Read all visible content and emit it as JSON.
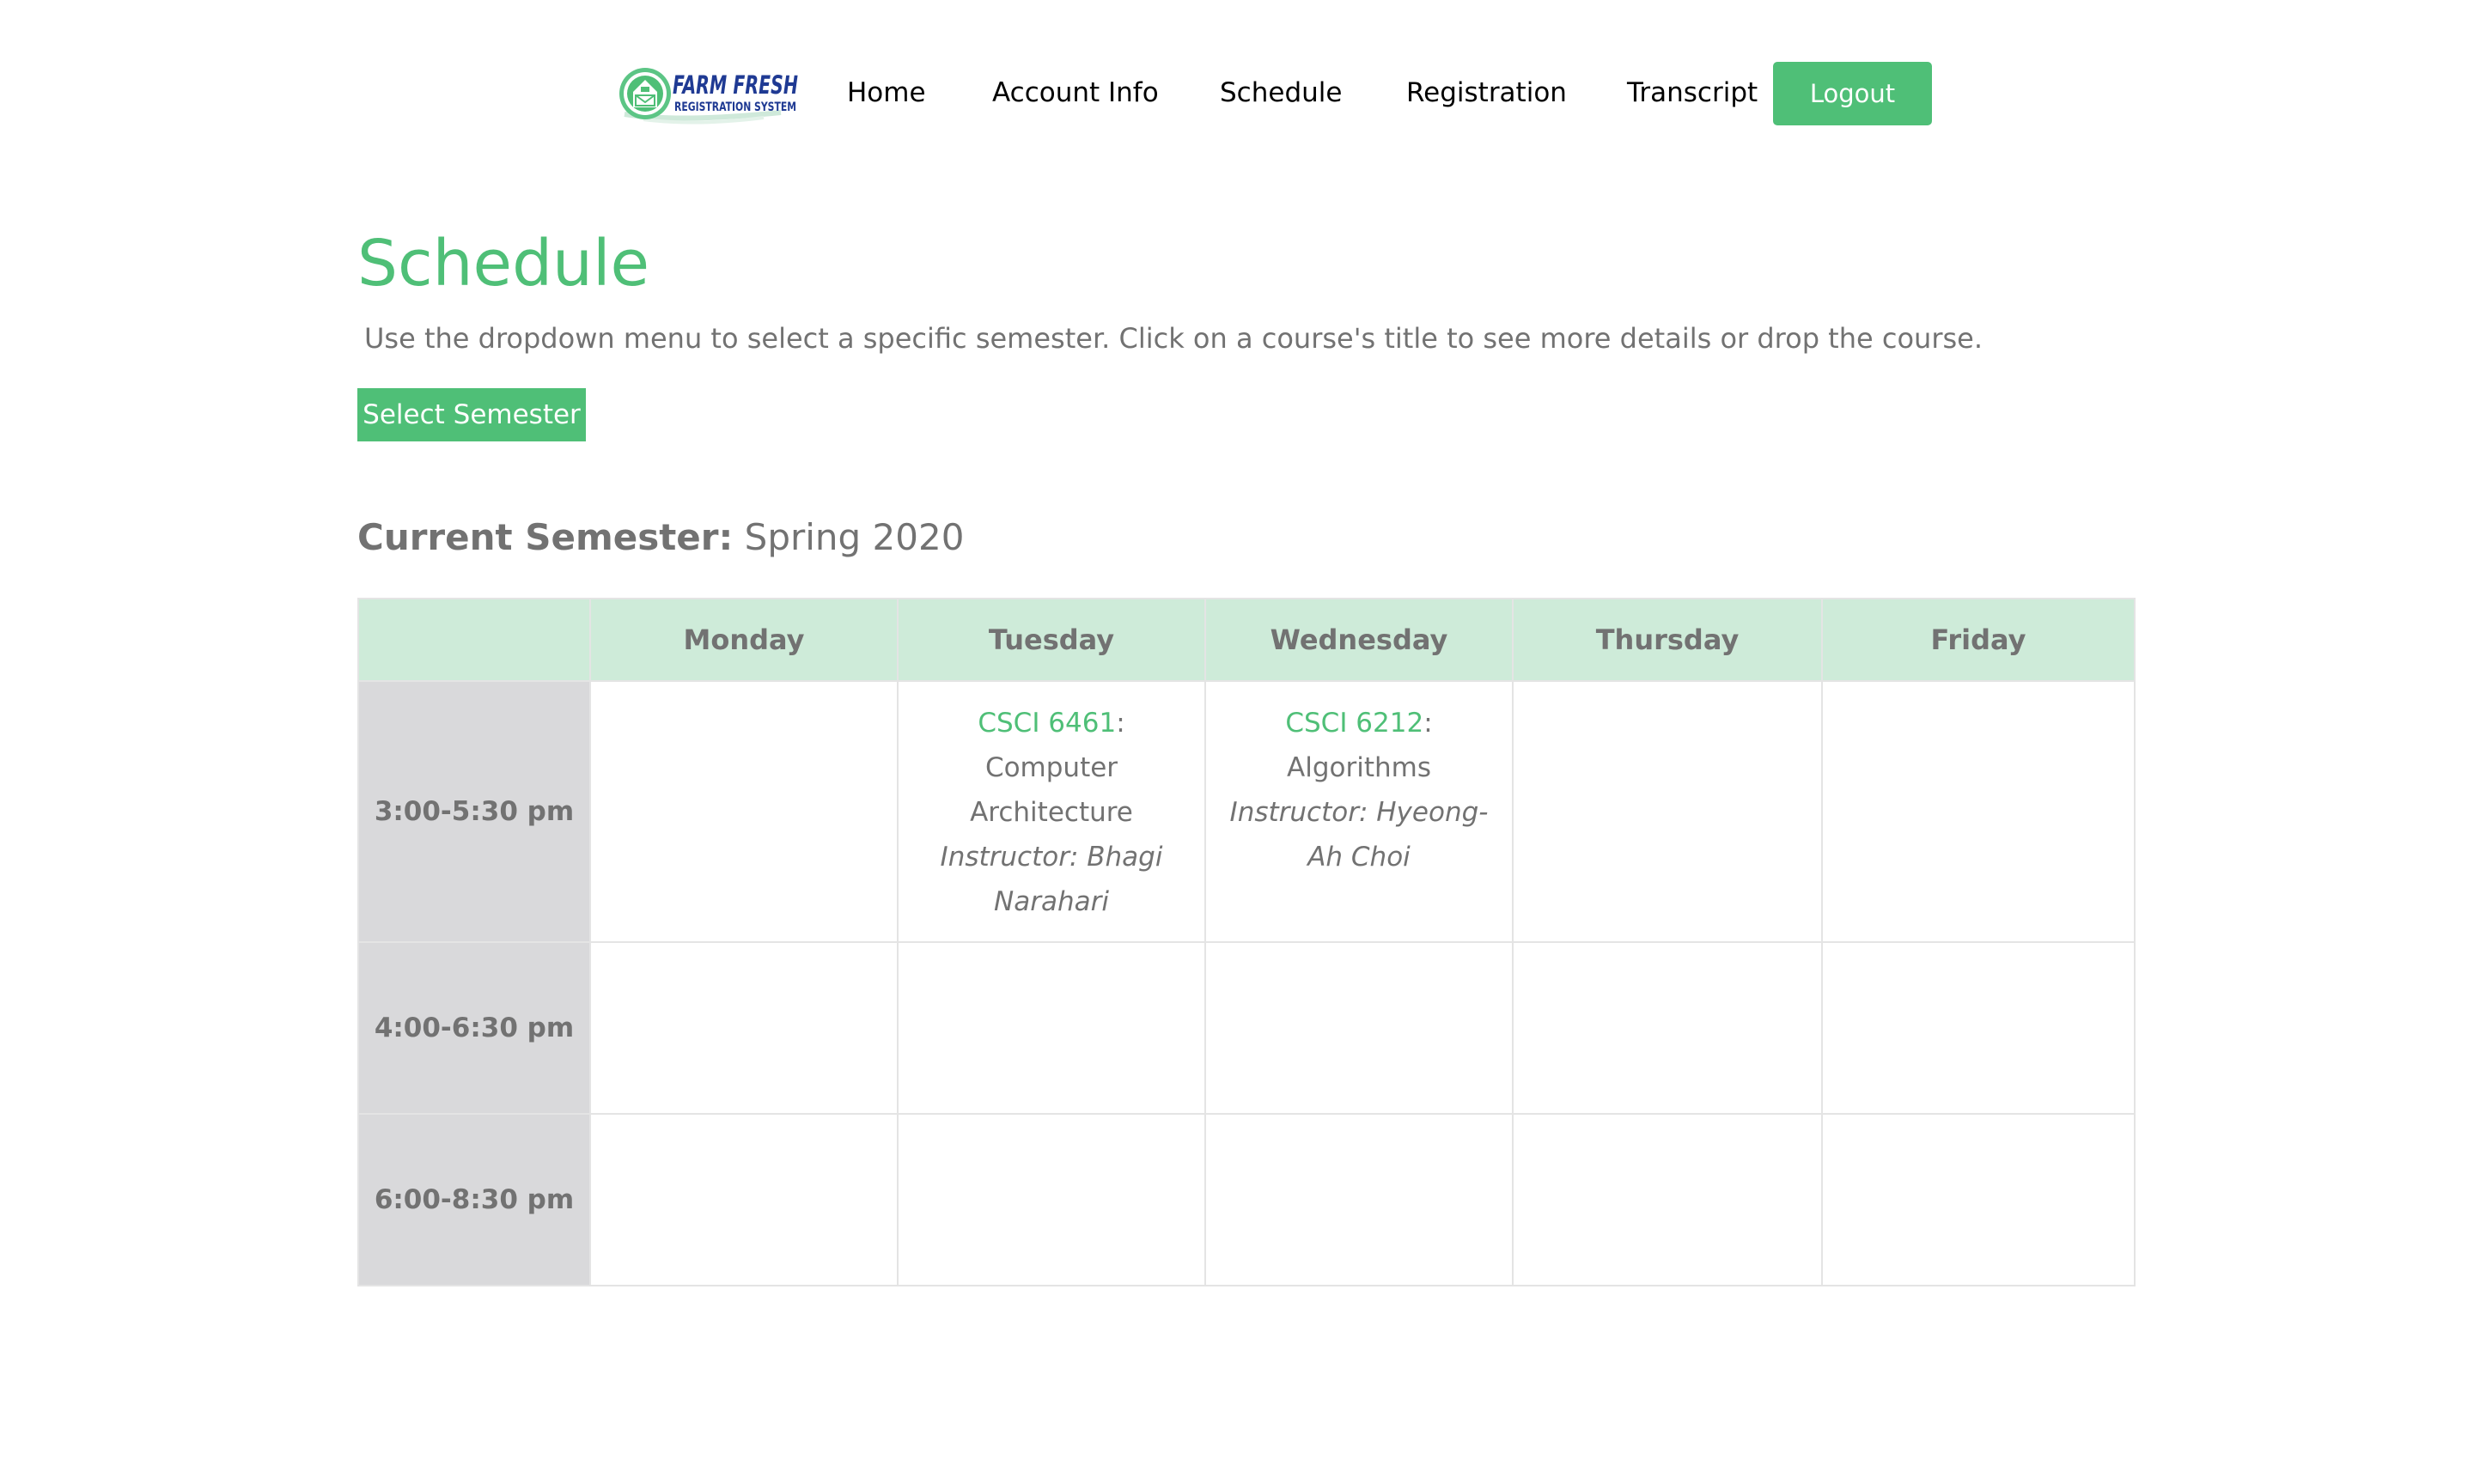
{
  "brand": {
    "logo_line1": "FARM FRESH",
    "logo_line2": "REGISTRATION SYSTEM"
  },
  "nav": {
    "home": "Home",
    "account_info": "Account Info",
    "schedule": "Schedule",
    "registration": "Registration",
    "transcript": "Transcript",
    "logout": "Logout"
  },
  "page": {
    "title": "Schedule",
    "instructions": "Use the dropdown menu to select a specific semester. Click on a course's title to see more details or drop the course.",
    "select_semester_label": "Select Semester",
    "current_semester_label": "Current Semester:",
    "current_semester_value": "Spring 2020"
  },
  "table": {
    "days": [
      "Monday",
      "Tuesday",
      "Wednesday",
      "Thursday",
      "Friday"
    ],
    "time_slots": [
      "3:00-5:30 pm",
      "4:00-6:30 pm",
      "6:00-8:30 pm"
    ],
    "courses": [
      {
        "code": "CSCI 6461",
        "separator": ":",
        "title": "Computer Architecture",
        "instructor": "Instructor: Bhagi Narahari"
      },
      {
        "code": "CSCI 6212",
        "separator": ":",
        "title": "Algorithms",
        "instructor": "Instructor: Hyeong-Ah Choi"
      }
    ]
  },
  "colors": {
    "accent": "#4fbf77",
    "header_bg": "#ceebd9",
    "time_col_bg": "#d9d9db",
    "text_muted": "#727272",
    "logo_navy": "#1f3a93"
  }
}
